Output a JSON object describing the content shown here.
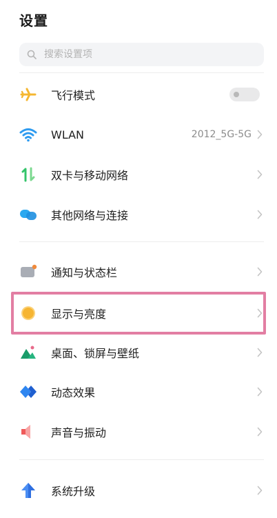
{
  "header": {
    "title": "设置"
  },
  "search": {
    "placeholder": "搜索设置项",
    "value": ""
  },
  "items": [
    {
      "id": "airplane",
      "label": "飞行模式",
      "icon": "airplane-icon",
      "icon_color": "#f5b731",
      "control": "toggle",
      "toggle_on": false
    },
    {
      "id": "wlan",
      "label": "WLAN",
      "icon": "wifi-icon",
      "icon_color": "#2e9bf0",
      "value": "2012_5G-5G",
      "control": "chevron"
    },
    {
      "id": "dual-sim",
      "label": "双卡与移动网络",
      "icon": "mobile-data-icon",
      "icon_color": "#33c46a",
      "control": "chevron"
    },
    {
      "id": "other-network",
      "label": "其他网络与连接",
      "icon": "connection-icon",
      "icon_color": "#2aa8f0",
      "control": "chevron"
    },
    {
      "id": "notification",
      "label": "通知与状态栏",
      "icon": "notification-icon",
      "icon_color": "#a9adb5",
      "control": "chevron"
    },
    {
      "id": "display",
      "label": "显示与亮度",
      "icon": "brightness-icon",
      "icon_color": "#f6b532",
      "control": "chevron"
    },
    {
      "id": "wallpaper",
      "label": "桌面、锁屏与壁纸",
      "icon": "wallpaper-icon",
      "icon_color": "#26b47f",
      "control": "chevron"
    },
    {
      "id": "dynamic-effects",
      "label": "动态效果",
      "icon": "effects-icon",
      "icon_color": "#2f86f0",
      "control": "chevron"
    },
    {
      "id": "sound",
      "label": "声音与振动",
      "icon": "sound-icon",
      "icon_color": "#ef5a5a",
      "control": "chevron"
    },
    {
      "id": "system-update",
      "label": "系统升级",
      "icon": "upgrade-icon",
      "icon_color": "#4b8ef3",
      "control": "chevron"
    }
  ],
  "highlight_color": "#e27ea3"
}
